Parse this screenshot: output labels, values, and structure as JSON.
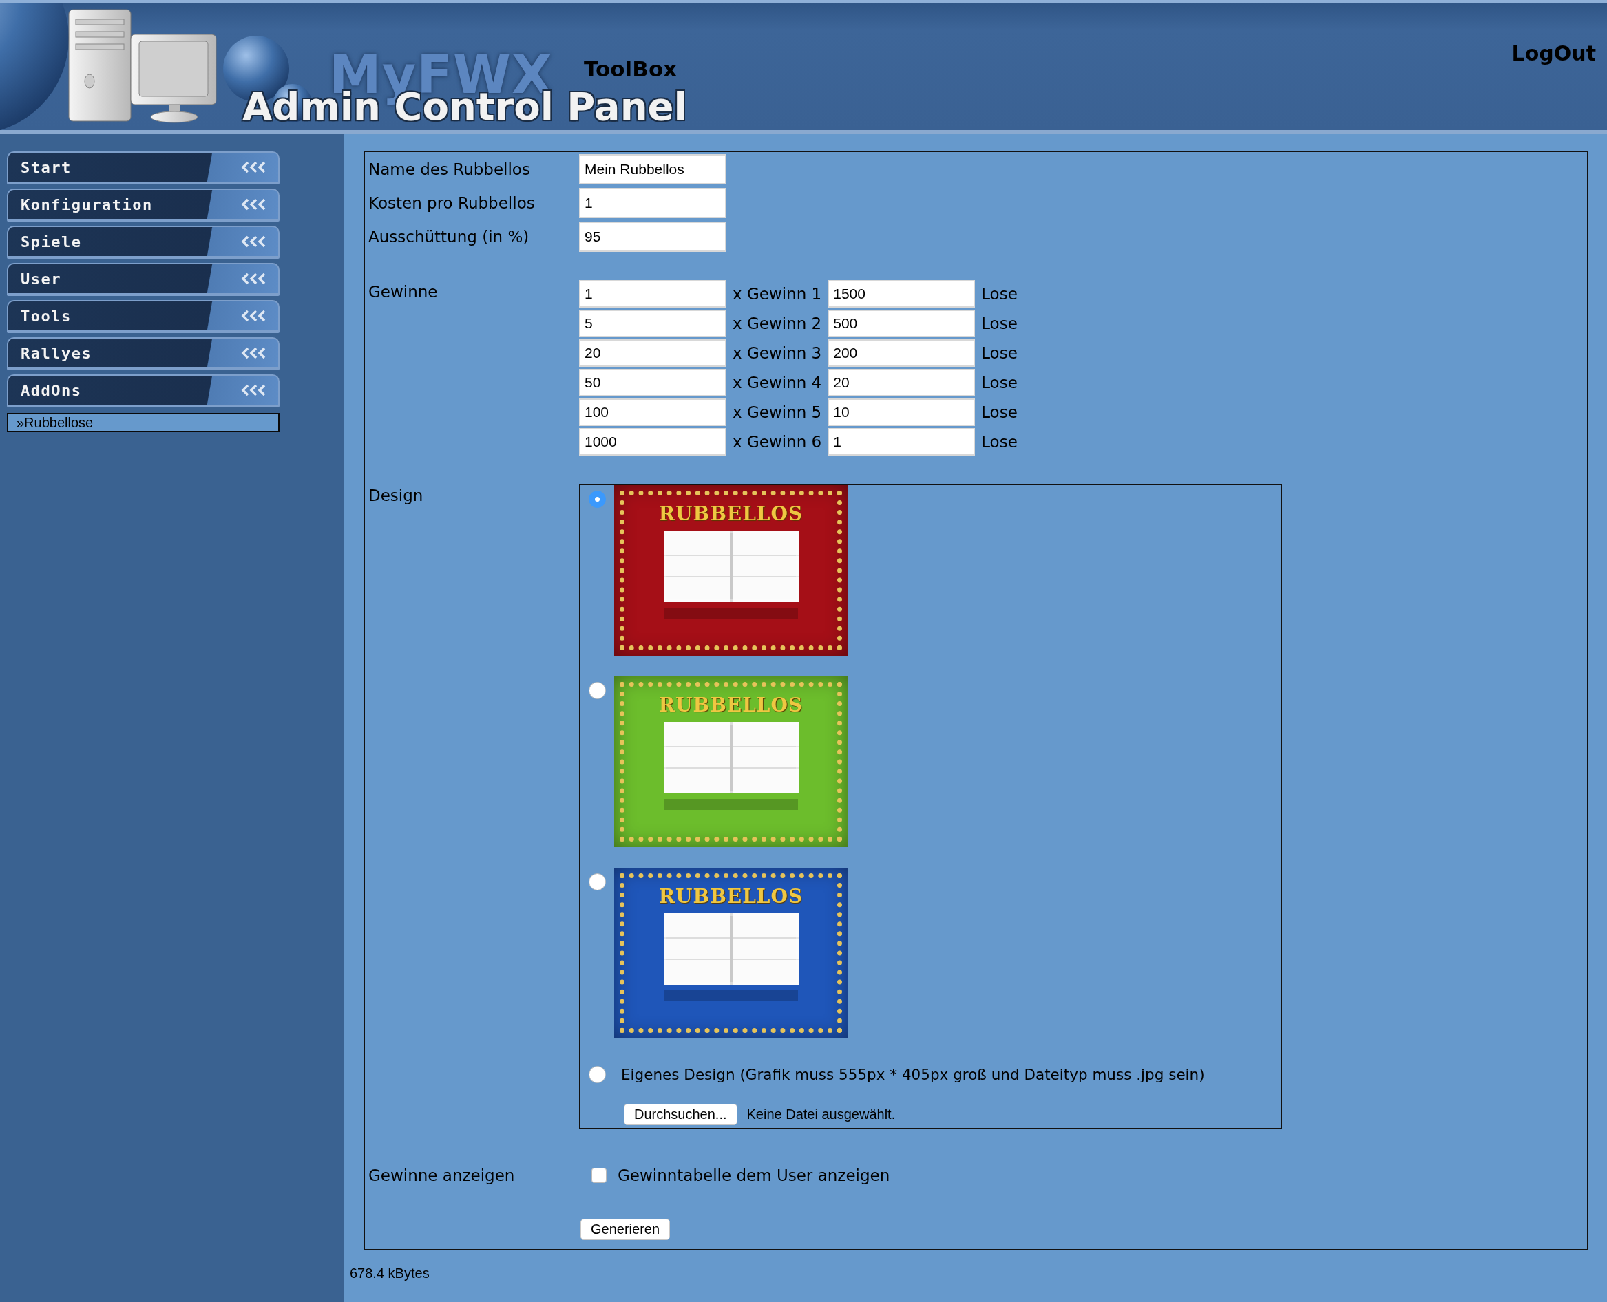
{
  "header": {
    "logo_top": "MyFWX",
    "logo_bottom": "Admin Control Panel",
    "toolbox_link": "ToolBox",
    "logout_link": "LogOut"
  },
  "sidebar": {
    "items": [
      {
        "label": "Start"
      },
      {
        "label": "Konfiguration"
      },
      {
        "label": "Spiele"
      },
      {
        "label": "User"
      },
      {
        "label": "Tools"
      },
      {
        "label": "Rallyes"
      },
      {
        "label": "AddOns"
      }
    ],
    "subitems": [
      {
        "label": "»Rubbellose"
      }
    ]
  },
  "form": {
    "fields": [
      {
        "label": "Name des Rubbellos",
        "value": "Mein Rubbellos"
      },
      {
        "label": "Kosten pro Rubbellos",
        "value": "1"
      },
      {
        "label": "Ausschüttung (in %)",
        "value": "95"
      }
    ],
    "prizes": {
      "label": "Gewinne",
      "rows": [
        {
          "count": "1",
          "name": "x Gewinn 1",
          "tickets": "1500",
          "unit": "Lose"
        },
        {
          "count": "5",
          "name": "x Gewinn 2",
          "tickets": "500",
          "unit": "Lose"
        },
        {
          "count": "20",
          "name": "x Gewinn 3",
          "tickets": "200",
          "unit": "Lose"
        },
        {
          "count": "50",
          "name": "x Gewinn 4",
          "tickets": "20",
          "unit": "Lose"
        },
        {
          "count": "100",
          "name": "x Gewinn 5",
          "tickets": "10",
          "unit": "Lose"
        },
        {
          "count": "1000",
          "name": "x Gewinn 6",
          "tickets": "1",
          "unit": "Lose"
        }
      ]
    },
    "design": {
      "label": "Design",
      "options": [
        {
          "kind": "image",
          "title": "RUBBELLOS",
          "color": "#a50f17",
          "selected": true
        },
        {
          "kind": "image",
          "title": "RUBBELLOS",
          "color": "#6cbd2c",
          "selected": false
        },
        {
          "kind": "image",
          "title": "RUBBELLOS",
          "color": "#1f56b9",
          "selected": false
        },
        {
          "kind": "custom",
          "text": "Eigenes Design (Grafik muss 555px * 405px groß und Dateityp muss .jpg sein)",
          "selected": false
        }
      ],
      "file": {
        "button": "Durchsuchen...",
        "status": "Keine Datei ausgewählt."
      }
    },
    "show_prizes": {
      "label": "Gewinne anzeigen",
      "checkbox_label": "Gewinntabelle dem User anzeigen",
      "checked": false
    },
    "submit": "Generieren"
  },
  "footer": {
    "size": "678.4 kBytes"
  }
}
